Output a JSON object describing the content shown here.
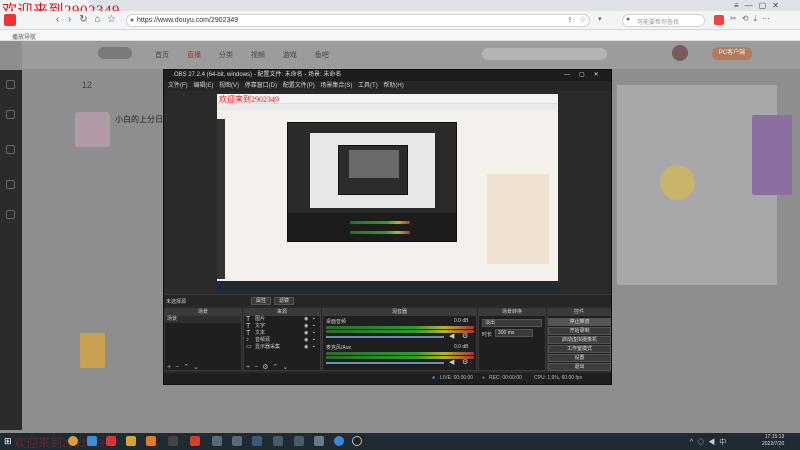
{
  "overlay": {
    "text": "欢迎来到2902349"
  },
  "browser": {
    "url": "https://www.douyu.com/2902349",
    "search_placeholder": "可能要帮你查找",
    "bookmark": "播放导航"
  },
  "site": {
    "nav": [
      "首页",
      "直播",
      "分类",
      "视频",
      "游戏",
      "鱼吧"
    ],
    "streamer_title": "小白的上分日",
    "stat_number": "12",
    "right_btn": "PC客户端"
  },
  "obs": {
    "title": "OBS 27.2.4 (64-bit, windows) - 配置文件: 未命名 - 场景: 未命名",
    "menu": [
      "文件(F)",
      "编辑(E)",
      "视图(V)",
      "停靠窗口(D)",
      "配置文件(P)",
      "场景集合(S)",
      "工具(T)",
      "帮助(H)"
    ],
    "source_label": "未选择源",
    "props_btn": "属性",
    "filter_btn": "滤镜",
    "panels": {
      "scenes": "场景",
      "sources": "来源",
      "mixer": "混音器",
      "transitions": "场景转换",
      "controls": "控件"
    },
    "scene_item": "场景",
    "sources": [
      "图片",
      "文字",
      "文本",
      "音频源",
      "显示器采集"
    ],
    "mixer": [
      {
        "name": "桌面音频",
        "db": "0.0 dB"
      },
      {
        "name": "麦克风/Aux",
        "db": "0.0 dB"
      }
    ],
    "transition": {
      "type": "淡出",
      "duration_label": "时长",
      "duration": "300 ms"
    },
    "controls": [
      "停止推流",
      "开始录制",
      "启动虚拟摄像机",
      "工作室模式",
      "设置",
      "退出"
    ],
    "status": {
      "live": "LIVE: 00:00:00",
      "rec": "REC: 00:00:00",
      "cpu": "CPU: 1.9%, 60.00 fps"
    }
  },
  "taskbar": {
    "time": "17:15:13",
    "date": "2022/7/20"
  }
}
